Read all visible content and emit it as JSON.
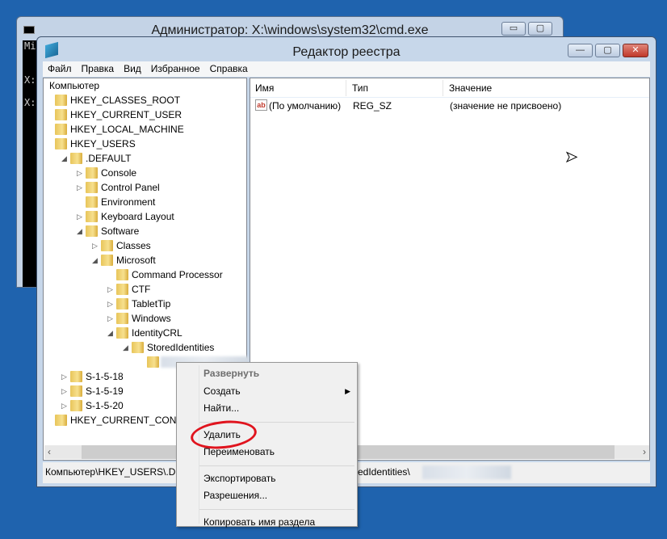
{
  "cmd_window": {
    "title": "Администратор: X:\\windows\\system32\\cmd.exe",
    "console_lines": [
      "Mi",
      "",
      "X:",
      "",
      "X:"
    ],
    "buttons": {
      "minimize": "▭",
      "maximize": "▢",
      "close": "✕"
    }
  },
  "regedit": {
    "title": "Редактор реестра",
    "buttons": {
      "minimize": "—",
      "maximize": "▢",
      "close": "✕"
    },
    "menu": [
      "Файл",
      "Правка",
      "Вид",
      "Избранное",
      "Справка"
    ],
    "tree": [
      {
        "label": "Компьютер",
        "level": -1,
        "toggle": ""
      },
      {
        "label": "HKEY_CLASSES_ROOT",
        "level": 0,
        "toggle": ""
      },
      {
        "label": "HKEY_CURRENT_USER",
        "level": 0,
        "toggle": ""
      },
      {
        "label": "HKEY_LOCAL_MACHINE",
        "level": 0,
        "toggle": ""
      },
      {
        "label": "HKEY_USERS",
        "level": 0,
        "toggle": ""
      },
      {
        "label": ".DEFAULT",
        "level": 1,
        "toggle": "expanded"
      },
      {
        "label": "Console",
        "level": 2,
        "toggle": "collapsed"
      },
      {
        "label": "Control Panel",
        "level": 2,
        "toggle": "collapsed"
      },
      {
        "label": "Environment",
        "level": 2,
        "toggle": ""
      },
      {
        "label": "Keyboard Layout",
        "level": 2,
        "toggle": "collapsed"
      },
      {
        "label": "Software",
        "level": 2,
        "toggle": "expanded"
      },
      {
        "label": "Classes",
        "level": 3,
        "toggle": "collapsed"
      },
      {
        "label": "Microsoft",
        "level": 3,
        "toggle": "expanded"
      },
      {
        "label": "Command Processor",
        "level": 4,
        "toggle": ""
      },
      {
        "label": "CTF",
        "level": 4,
        "toggle": "collapsed"
      },
      {
        "label": "TabletTip",
        "level": 4,
        "toggle": "collapsed"
      },
      {
        "label": "Windows",
        "level": 4,
        "toggle": "collapsed"
      },
      {
        "label": "IdentityCRL",
        "level": 4,
        "toggle": "expanded"
      },
      {
        "label": "StoredIdentities",
        "level": 5,
        "toggle": "expanded"
      },
      {
        "label": "",
        "level": 6,
        "toggle": "",
        "blurred": true,
        "selected": true
      },
      {
        "label": "S-1-5-18",
        "level": 1,
        "toggle": "collapsed"
      },
      {
        "label": "S-1-5-19",
        "level": 1,
        "toggle": "collapsed"
      },
      {
        "label": "S-1-5-20",
        "level": 1,
        "toggle": "collapsed"
      },
      {
        "label": "HKEY_CURRENT_CONFIG",
        "level": 0,
        "toggle": ""
      }
    ],
    "columns": {
      "name": "Имя",
      "type": "Тип",
      "value": "Значение"
    },
    "values": [
      {
        "icon": "ab",
        "name": "(По умолчанию)",
        "type": "REG_SZ",
        "data": "(значение не присвоено)"
      }
    ],
    "status": {
      "path_start": "Компьютер\\HKEY_USERS\\.DEF",
      "path_end": "redIdentities\\"
    }
  },
  "context_menu": {
    "items": [
      {
        "label": "Развернуть",
        "disabled": true,
        "bold": true
      },
      {
        "label": "Создать",
        "submenu": true
      },
      {
        "label": "Найти..."
      },
      {
        "sep": true
      },
      {
        "label": "Удалить",
        "highlighted_by_annotation": true
      },
      {
        "label": "Переименовать"
      },
      {
        "sep": true
      },
      {
        "label": "Экспортировать"
      },
      {
        "label": "Разрешения..."
      },
      {
        "sep": true
      },
      {
        "label": "Копировать имя раздела"
      }
    ]
  },
  "colors": {
    "desktop": "#1f63ae",
    "annotation": "#e0141e",
    "close_button": "#c9483a"
  }
}
